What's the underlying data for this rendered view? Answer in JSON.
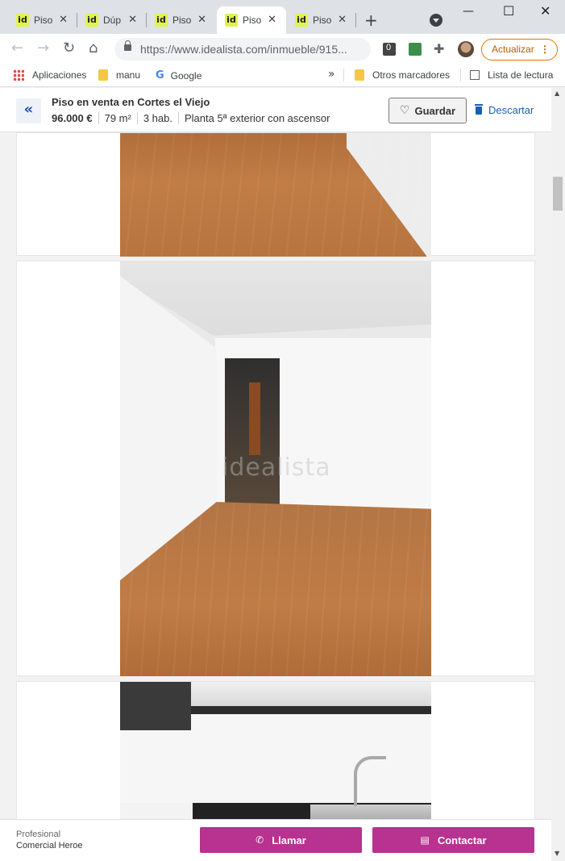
{
  "browser": {
    "tabs": [
      {
        "title": "Piso",
        "active": false
      },
      {
        "title": "Dúp",
        "active": false
      },
      {
        "title": "Piso",
        "active": false
      },
      {
        "title": "Piso",
        "active": true
      },
      {
        "title": "Piso",
        "active": false
      }
    ],
    "favicon_text": "id",
    "new_tab_icon": "+",
    "url": "https://www.idealista.com/inmueble/915...",
    "update_label": "Actualizar",
    "accent_color": "#e37400"
  },
  "bookmarks": {
    "items": [
      {
        "label": "Aplicaciones",
        "icon": "apps-icon"
      },
      {
        "label": "manu",
        "icon": "folder-icon"
      },
      {
        "label": "Google",
        "icon": "google-icon"
      }
    ],
    "other_label": "Otros marcadores",
    "reading_list_label": "Lista de lectura"
  },
  "listing": {
    "title": "Piso en venta en Cortes el Viejo",
    "price": "96.000 €",
    "area": "79 m²",
    "rooms": "3 hab.",
    "floor": "Planta 5ª exterior con ascensor",
    "save_label": "Guardar",
    "discard_label": "Descartar",
    "watermark": "idealista"
  },
  "footer": {
    "profile_label": "Profesional",
    "agency_name": "Comercial Heroe",
    "call_label": "Llamar",
    "contact_label": "Contactar",
    "cta_color": "#b8328f"
  }
}
